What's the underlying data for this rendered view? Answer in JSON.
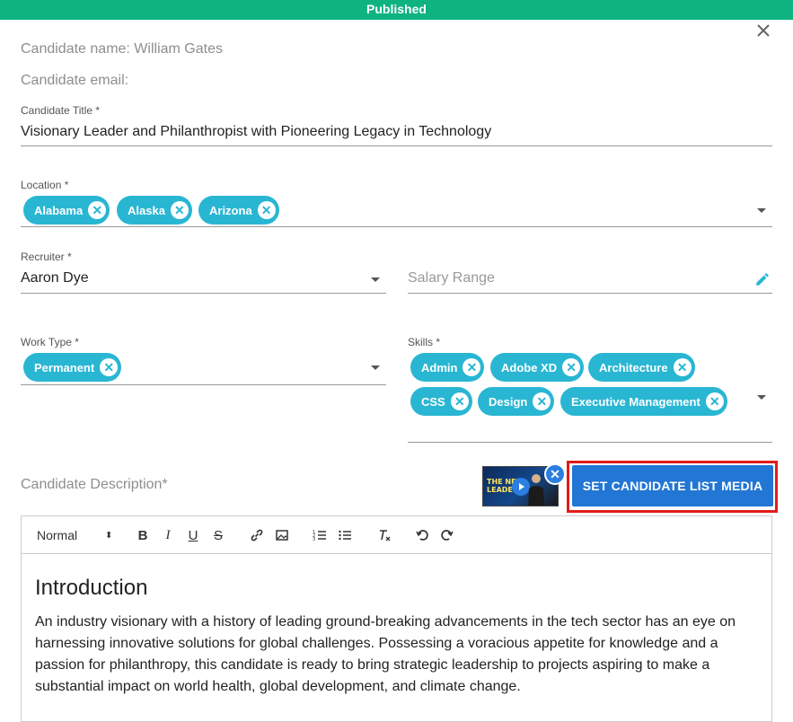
{
  "banner": {
    "status": "Published"
  },
  "candidate": {
    "name_line": "Candidate name: William Gates",
    "email_line": "Candidate email:"
  },
  "title_field": {
    "label": "Candidate Title *",
    "value": "Visionary Leader and Philanthropist with Pioneering Legacy in Technology"
  },
  "location_field": {
    "label": "Location *",
    "chips": [
      "Alabama",
      "Alaska",
      "Arizona"
    ]
  },
  "recruiter_field": {
    "label": "Recruiter *",
    "value": "Aaron Dye"
  },
  "salary_field": {
    "placeholder": "Salary Range"
  },
  "work_type_field": {
    "label": "Work Type *",
    "chips": [
      "Permanent"
    ]
  },
  "skills_field": {
    "label": "Skills *",
    "chips": [
      "Admin",
      "Adobe XD",
      "Architecture",
      "CSS",
      "Design",
      "Executive Management"
    ]
  },
  "description": {
    "label": "Candidate Description*",
    "media_button": "SET CANDIDATE LIST MEDIA",
    "thumbnail_text": "THE NEW LEADERS"
  },
  "editor": {
    "format_select": "Normal",
    "heading": "Introduction",
    "paragraph": "An industry visionary with a history of leading ground-breaking advancements in the tech sector has an eye on harnessing innovative solutions for global challenges. Possessing a voracious appetite for knowledge and a passion for philanthropy, this candidate is ready to bring strategic leadership to projects aspiring to make a substantial impact on world health, global development, and climate change."
  },
  "colors": {
    "banner": "#0fb37f",
    "chip": "#29b6d3",
    "primary_button": "#2276d4",
    "highlight": "#e21b1b"
  }
}
